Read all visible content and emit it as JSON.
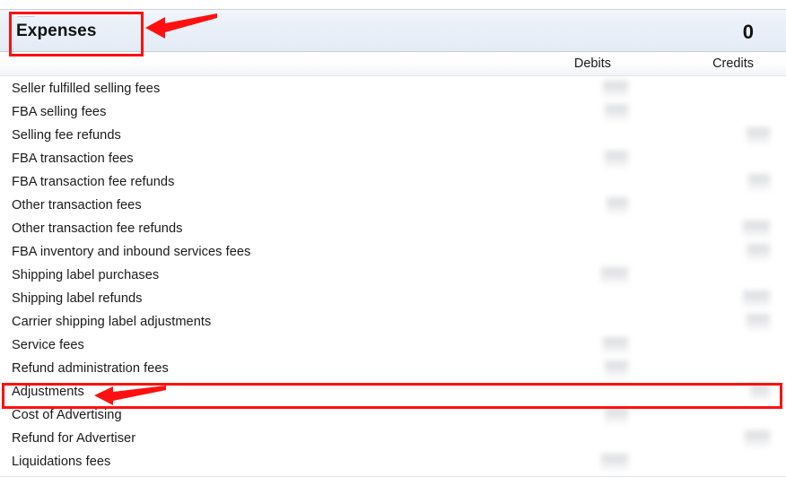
{
  "section": {
    "title": "Expenses",
    "total": "0",
    "collapse_icon": "collapse-handle-icon"
  },
  "columns": {
    "debits_label": "Debits",
    "credits_label": "Credits"
  },
  "rows": [
    {
      "label": "Seller fulfilled selling fees",
      "debit": true,
      "credit": false
    },
    {
      "label": "FBA selling fees",
      "debit": true,
      "credit": false
    },
    {
      "label": "Selling fee refunds",
      "debit": false,
      "credit": true
    },
    {
      "label": "FBA transaction fees",
      "debit": true,
      "credit": false
    },
    {
      "label": "FBA transaction fee refunds",
      "debit": false,
      "credit": true
    },
    {
      "label": "Other transaction fees",
      "debit": true,
      "credit": false
    },
    {
      "label": "Other transaction fee refunds",
      "debit": false,
      "credit": true
    },
    {
      "label": "FBA inventory and inbound services fees",
      "debit": false,
      "credit": true
    },
    {
      "label": "Shipping label purchases",
      "debit": true,
      "credit": false
    },
    {
      "label": "Shipping label refunds",
      "debit": false,
      "credit": true
    },
    {
      "label": "Carrier shipping label adjustments",
      "debit": false,
      "credit": true
    },
    {
      "label": "Service fees",
      "debit": true,
      "credit": false
    },
    {
      "label": "Refund administration fees",
      "debit": true,
      "credit": false
    },
    {
      "label": "Adjustments",
      "debit": false,
      "credit": true
    },
    {
      "label": "Cost of Advertising",
      "debit": true,
      "credit": false
    },
    {
      "label": "Refund for Advertiser",
      "debit": false,
      "credit": true
    },
    {
      "label": "Liquidations fees",
      "debit": true,
      "credit": false
    }
  ],
  "annotations": {
    "color": "#ff1010",
    "items": [
      {
        "name": "expenses-header-highlight",
        "target": "Expenses"
      },
      {
        "name": "expenses-header-arrow",
        "target": "Expenses"
      },
      {
        "name": "adjustments-row-highlight",
        "target": "Adjustments"
      },
      {
        "name": "adjustments-row-arrow",
        "target": "Adjustments"
      }
    ]
  }
}
